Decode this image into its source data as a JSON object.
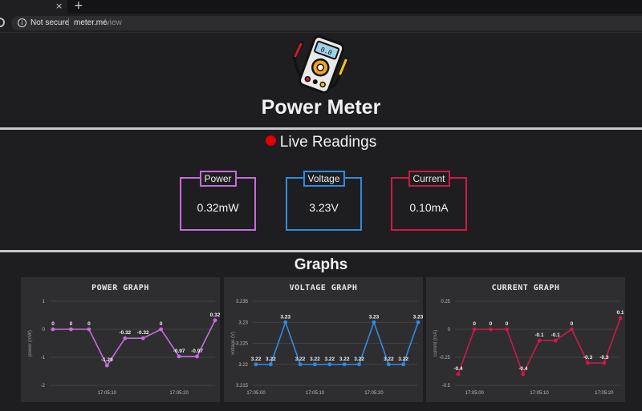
{
  "browser": {
    "tab_close": "×",
    "new_tab": "+",
    "security": "Not secure",
    "separator": "|",
    "url_host": "meter.me",
    "url_path": "/view"
  },
  "page": {
    "title": "Power Meter",
    "logo_icon": "multimeter-icon"
  },
  "live": {
    "title": "Live Readings",
    "status_color": "#e00000",
    "cards": [
      {
        "label": "Power",
        "value": "0.32mW",
        "color": "#c86bdc"
      },
      {
        "label": "Voltage",
        "value": "3.23V",
        "color": "#2f8be0"
      },
      {
        "label": "Current",
        "value": "0.10mA",
        "color": "#d01845"
      }
    ]
  },
  "graphs_title": "Graphs",
  "chart_data": [
    {
      "id": "power",
      "type": "line",
      "title": "POWER GRAPH",
      "ylabel": "power (mW)",
      "color": "#c86bdc",
      "ylim": [
        -2,
        1
      ],
      "yticks": [
        1,
        0,
        -1,
        -2
      ],
      "xticks": [
        "17:05:10",
        "17:05:20"
      ],
      "xtick_index": [
        3,
        7
      ],
      "values": [
        0,
        0,
        0,
        -1.29,
        -0.32,
        -0.32,
        0,
        -0.97,
        -0.97,
        0.32
      ],
      "labels": [
        "0",
        "0",
        "0",
        "-1.29",
        "-0.32",
        "-0.32",
        "0",
        "-0.97",
        "-0.97",
        "0.32"
      ]
    },
    {
      "id": "voltage",
      "type": "line",
      "title": "VOLTAGE GRAPH",
      "ylabel": "voltage (V)",
      "color": "#2f8be0",
      "ylim": [
        3.215,
        3.235
      ],
      "yticks": [
        3.235,
        3.23,
        3.225,
        3.22,
        3.215
      ],
      "xticks": [
        "17:05:00",
        "17:05:10",
        "17:05:20"
      ],
      "xtick_index": [
        0,
        4,
        8
      ],
      "values": [
        3.22,
        3.22,
        3.23,
        3.22,
        3.22,
        3.22,
        3.22,
        3.22,
        3.23,
        3.22,
        3.22,
        3.23
      ],
      "labels": [
        "3.22",
        "3.22",
        "3.23",
        "3.22",
        "3.22",
        "3.22",
        "3.22",
        "3.22",
        "3.23",
        "3.22",
        "3.22",
        "3.23"
      ]
    },
    {
      "id": "current",
      "type": "line",
      "title": "CURRENT GRAPH",
      "ylabel": "current (mA)",
      "color": "#d01845",
      "ylim": [
        -0.5,
        0.25
      ],
      "yticks": [
        0.25,
        0,
        -0.25,
        -0.5
      ],
      "xticks": [
        "17:05:00",
        "17:05:10",
        "17:05:20"
      ],
      "xtick_index": [
        1,
        5,
        9
      ],
      "values": [
        -0.4,
        0,
        0,
        0,
        -0.4,
        -0.1,
        -0.1,
        0,
        -0.3,
        -0.3,
        0.1
      ],
      "labels": [
        "-0.4",
        "0",
        "0",
        "0",
        "-0.4",
        "-0.1",
        "-0.1",
        "0",
        "-0.3",
        "-0.3",
        "0.1"
      ]
    }
  ]
}
